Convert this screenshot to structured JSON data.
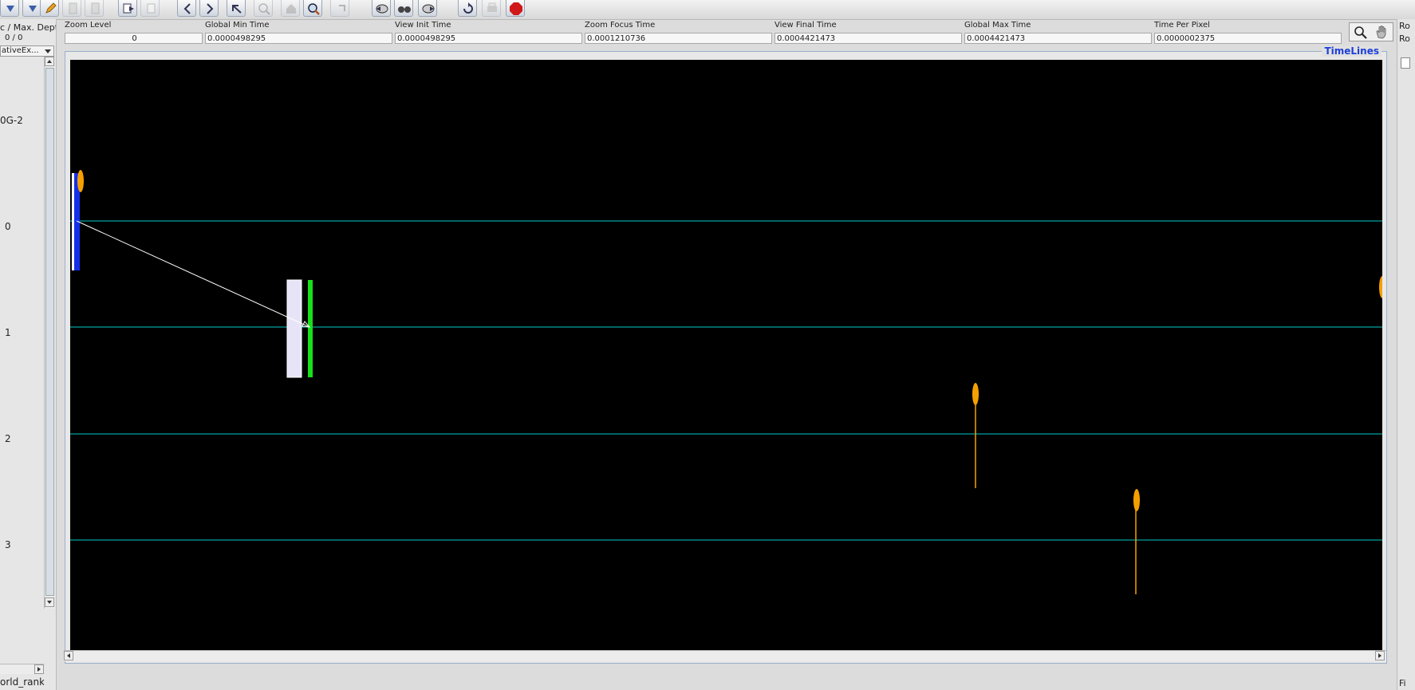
{
  "toolbar": {
    "buttons": [
      {
        "icon": "down-arrow-icon",
        "enabled": true
      },
      {
        "icon": "down-arrow-icon",
        "enabled": true
      },
      {
        "icon": "pencil-icon",
        "enabled": true
      },
      {
        "icon": "document-icon",
        "enabled": false
      },
      {
        "icon": "document-icon",
        "enabled": false
      },
      {
        "icon": "export-icon",
        "enabled": true
      },
      {
        "icon": "import-icon",
        "enabled": false
      },
      {
        "icon": "chevron-left-icon",
        "enabled": true
      },
      {
        "icon": "chevron-right-icon",
        "enabled": true
      },
      {
        "icon": "undo-icon",
        "enabled": true
      },
      {
        "icon": "zoom-out-icon",
        "enabled": false
      },
      {
        "icon": "home-icon",
        "enabled": false
      },
      {
        "icon": "zoom-in-icon",
        "enabled": true
      },
      {
        "icon": "redo-icon",
        "enabled": false
      },
      {
        "icon": "search-back-icon",
        "enabled": true
      },
      {
        "icon": "binoculars-icon",
        "enabled": true
      },
      {
        "icon": "search-forward-icon",
        "enabled": true
      },
      {
        "icon": "refresh-icon",
        "enabled": true
      },
      {
        "icon": "print-icon",
        "enabled": false
      },
      {
        "icon": "stop-icon",
        "enabled": true
      }
    ]
  },
  "left_panel": {
    "depth_label": "c / Max. Depth",
    "depth_value": "0 / 0",
    "view_selector": "ativeEx...",
    "tree_label": "0G-2",
    "row_labels": [
      "0",
      "1",
      "2",
      "3"
    ],
    "bottom_label": "orld_rank"
  },
  "info_bar": {
    "zoom_level": {
      "label": "Zoom Level",
      "value": "0"
    },
    "global_min_time": {
      "label": "Global Min Time",
      "value": "0.0000498295"
    },
    "view_init_time": {
      "label": "View  Init Time",
      "value": "0.0000498295"
    },
    "zoom_focus_time": {
      "label": "Zoom Focus Time",
      "value": "0.0001210736"
    },
    "view_final_time": {
      "label": "View Final Time",
      "value": "0.0004421473"
    },
    "global_max_time": {
      "label": "Global Max Time",
      "value": "0.0004421473"
    },
    "time_per_pixel": {
      "label": "Time Per Pixel",
      "value": "0.0000002375"
    }
  },
  "tools": {
    "search": "search-icon",
    "pan": "hand-icon"
  },
  "canvas": {
    "title": "TimeLines",
    "background": "#000000",
    "timeline_color": "#00c8c8",
    "state_colors": {
      "blue": "#1530e8",
      "lavender": "#e8e4f8",
      "green": "#18e018",
      "event": "#f5a000",
      "message": "#ffffff"
    }
  },
  "right_strip": {
    "labels": [
      "Ro",
      "Ro",
      "Fi"
    ]
  }
}
